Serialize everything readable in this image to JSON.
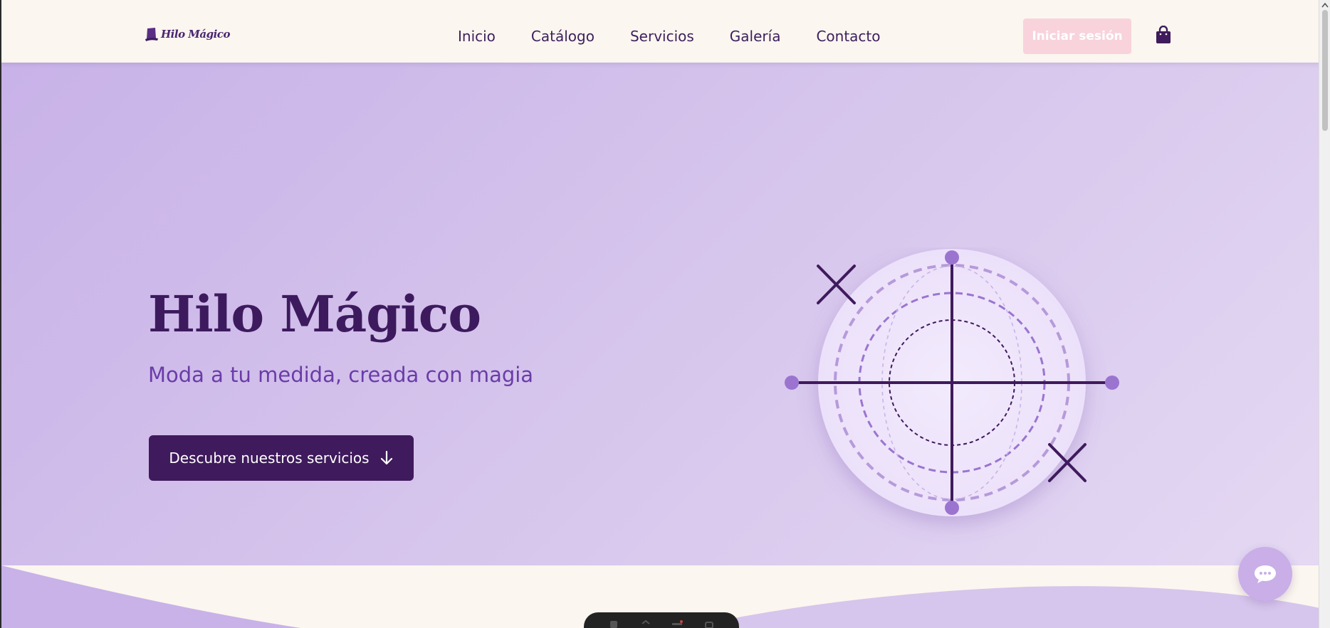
{
  "brand": {
    "name": "Hilo Mágico",
    "icon": "top-hat-icon"
  },
  "nav": {
    "items": [
      {
        "label": "Inicio"
      },
      {
        "label": "Catálogo"
      },
      {
        "label": "Servicios"
      },
      {
        "label": "Galería"
      },
      {
        "label": "Contacto"
      }
    ]
  },
  "header": {
    "login_label": "Iniciar sesión",
    "cart_icon": "shopping-bag-icon"
  },
  "hero": {
    "title": "Hilo Mágico",
    "subtitle": "Moda a tu medida, creada con magia",
    "cta_label": "Descubre nuestros servicios",
    "cta_icon": "arrow-down-icon"
  },
  "chat": {
    "icon": "chat-bubble-icon"
  },
  "colors": {
    "primary": "#3f1a5c",
    "accent": "#9b74d0",
    "hero_bg": "#d6c5ec",
    "page_bg": "#fbf6ef",
    "login_bg": "#f8d3dc"
  }
}
